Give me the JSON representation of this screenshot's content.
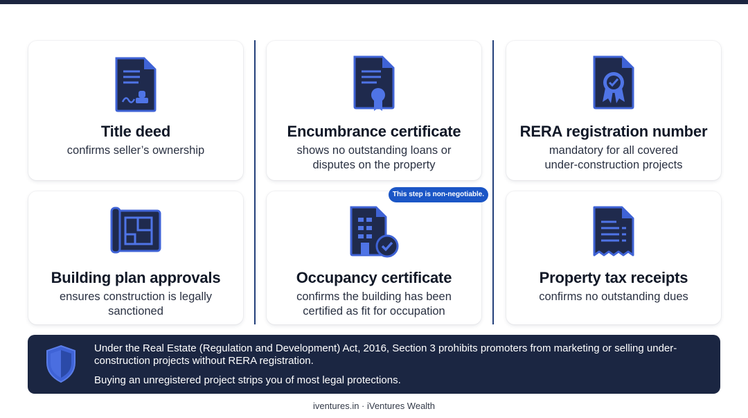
{
  "cards": [
    {
      "title": "Title deed",
      "desc": "confirms seller’s ownership",
      "icon": "title-deed-icon"
    },
    {
      "title": "Encumbrance certificate",
      "desc": "shows no outstanding loans or disputes on the property",
      "icon": "certificate-icon"
    },
    {
      "title": "RERA registration number",
      "desc": "mandatory for all covered under-construction projects",
      "icon": "verified-badge-icon"
    },
    {
      "title": "Building plan approvals",
      "desc": "ensures construction is legally sanctioned",
      "icon": "blueprint-icon"
    },
    {
      "title": "Occupancy certificate",
      "desc": "confirms the building has been certified as fit for occupation",
      "icon": "building-check-icon"
    },
    {
      "title": "Property tax receipts",
      "desc": "confirms no outstanding dues",
      "icon": "receipt-icon"
    }
  ],
  "badge": "This step is non-negotiable.",
  "note": {
    "line1": "Under the Real Estate (Regulation and Development) Act, 2016, Section 3 prohibits promoters from marketing or selling under-construction projects without RERA registration.",
    "line2": "Buying an unregistered project strips you of most legal protections."
  },
  "footer": "iventures.in · iVentures Wealth",
  "colors": {
    "navy": "#1b2642",
    "accent_blue": "#1b56c6",
    "icon_fill": "#1f2a4d",
    "icon_stroke": "#3f63d6"
  }
}
